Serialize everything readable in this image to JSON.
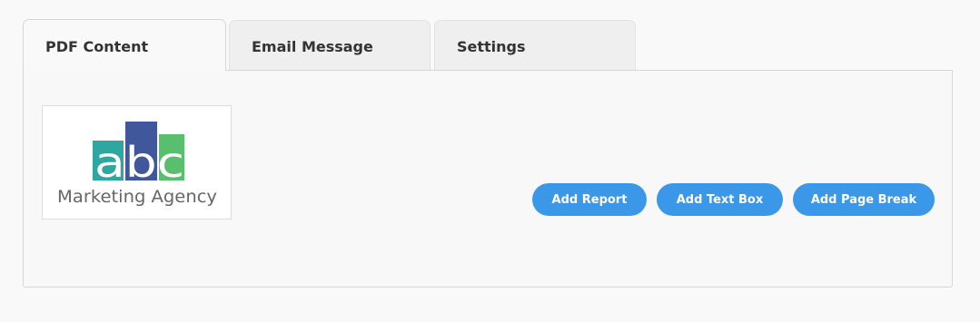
{
  "tabs": [
    {
      "label": "PDF Content",
      "active": true
    },
    {
      "label": "Email Message",
      "active": false
    },
    {
      "label": "Settings",
      "active": false
    }
  ],
  "logo": {
    "mark_text": "abc",
    "caption": "Marketing Agency",
    "colors": {
      "teal": "#2fa6a0",
      "blue": "#41579c",
      "green": "#57bf6d",
      "caption": "#666666"
    }
  },
  "actions": {
    "add_report": "Add Report",
    "add_text_box": "Add Text Box",
    "add_page_break": "Add Page Break"
  },
  "theme": {
    "button_color": "#3b97e8",
    "tab_inactive_bg": "#efefef",
    "page_bg": "#f9f9f9"
  }
}
